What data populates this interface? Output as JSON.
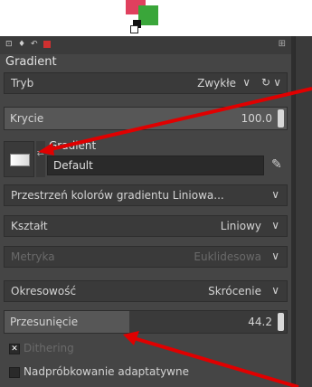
{
  "tool_options": {
    "title": "Gradient",
    "tabs": [
      "tool-options-icon",
      "device-status-icon",
      "undo-icon",
      "images-icon"
    ],
    "mode": {
      "label": "Tryb",
      "value": "Zwykłe"
    },
    "opacity": {
      "label": "Krycie",
      "value": "100.0"
    },
    "gradient": {
      "label": "Gradient",
      "name": "Default"
    },
    "blend_color_space": {
      "value": "Przestrzeń kolorów gradientu Liniowa..."
    },
    "shape": {
      "label": "Kształt",
      "value": "Liniowy"
    },
    "metric": {
      "label": "Metryka",
      "value": "Euklidesowa"
    },
    "repeat": {
      "label": "Okresowość",
      "value": "Skrócenie"
    },
    "offset": {
      "label": "Przesunięcie",
      "value": "44.2",
      "fraction": 0.442
    },
    "dithering": {
      "label": "Dithering",
      "checked": true
    },
    "adaptive": {
      "label": "Nadpróbkowanie adaptatywne",
      "checked": false
    }
  },
  "colors": {
    "panel_bg": "#454545",
    "arrow": "#e00000"
  }
}
